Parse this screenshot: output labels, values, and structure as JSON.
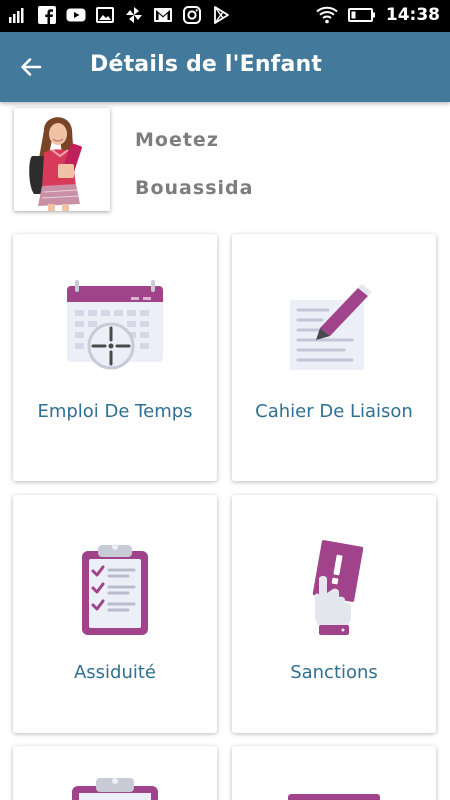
{
  "status_bar": {
    "time": "14:38",
    "left_icons": [
      "signal-bars-icon",
      "facebook-icon",
      "youtube-icon",
      "gallery-icon",
      "pinwheel-icon",
      "gmail-icon",
      "instagram-icon",
      "play-store-icon"
    ],
    "right_icons": [
      "wifi-icon",
      "battery-icon"
    ]
  },
  "app_bar": {
    "title": "Détails de l'Enfant",
    "back_icon": "arrow-left-icon"
  },
  "child": {
    "first_name": "Moetez",
    "last_name": "Bouassida"
  },
  "menu": [
    {
      "label": "Emploi De Temps",
      "icon": "calendar-clock-icon"
    },
    {
      "label": "Cahier De Liaison",
      "icon": "notebook-pencil-icon"
    },
    {
      "label": "Assiduité",
      "icon": "clipboard-checklist-icon"
    },
    {
      "label": "Sanctions",
      "icon": "hand-warning-card-icon"
    }
  ],
  "colors": {
    "app_bar": "#43799b",
    "accent_purple": "#a0438b",
    "label_blue": "#2f6f92",
    "name_gray": "#7d7d7d"
  }
}
